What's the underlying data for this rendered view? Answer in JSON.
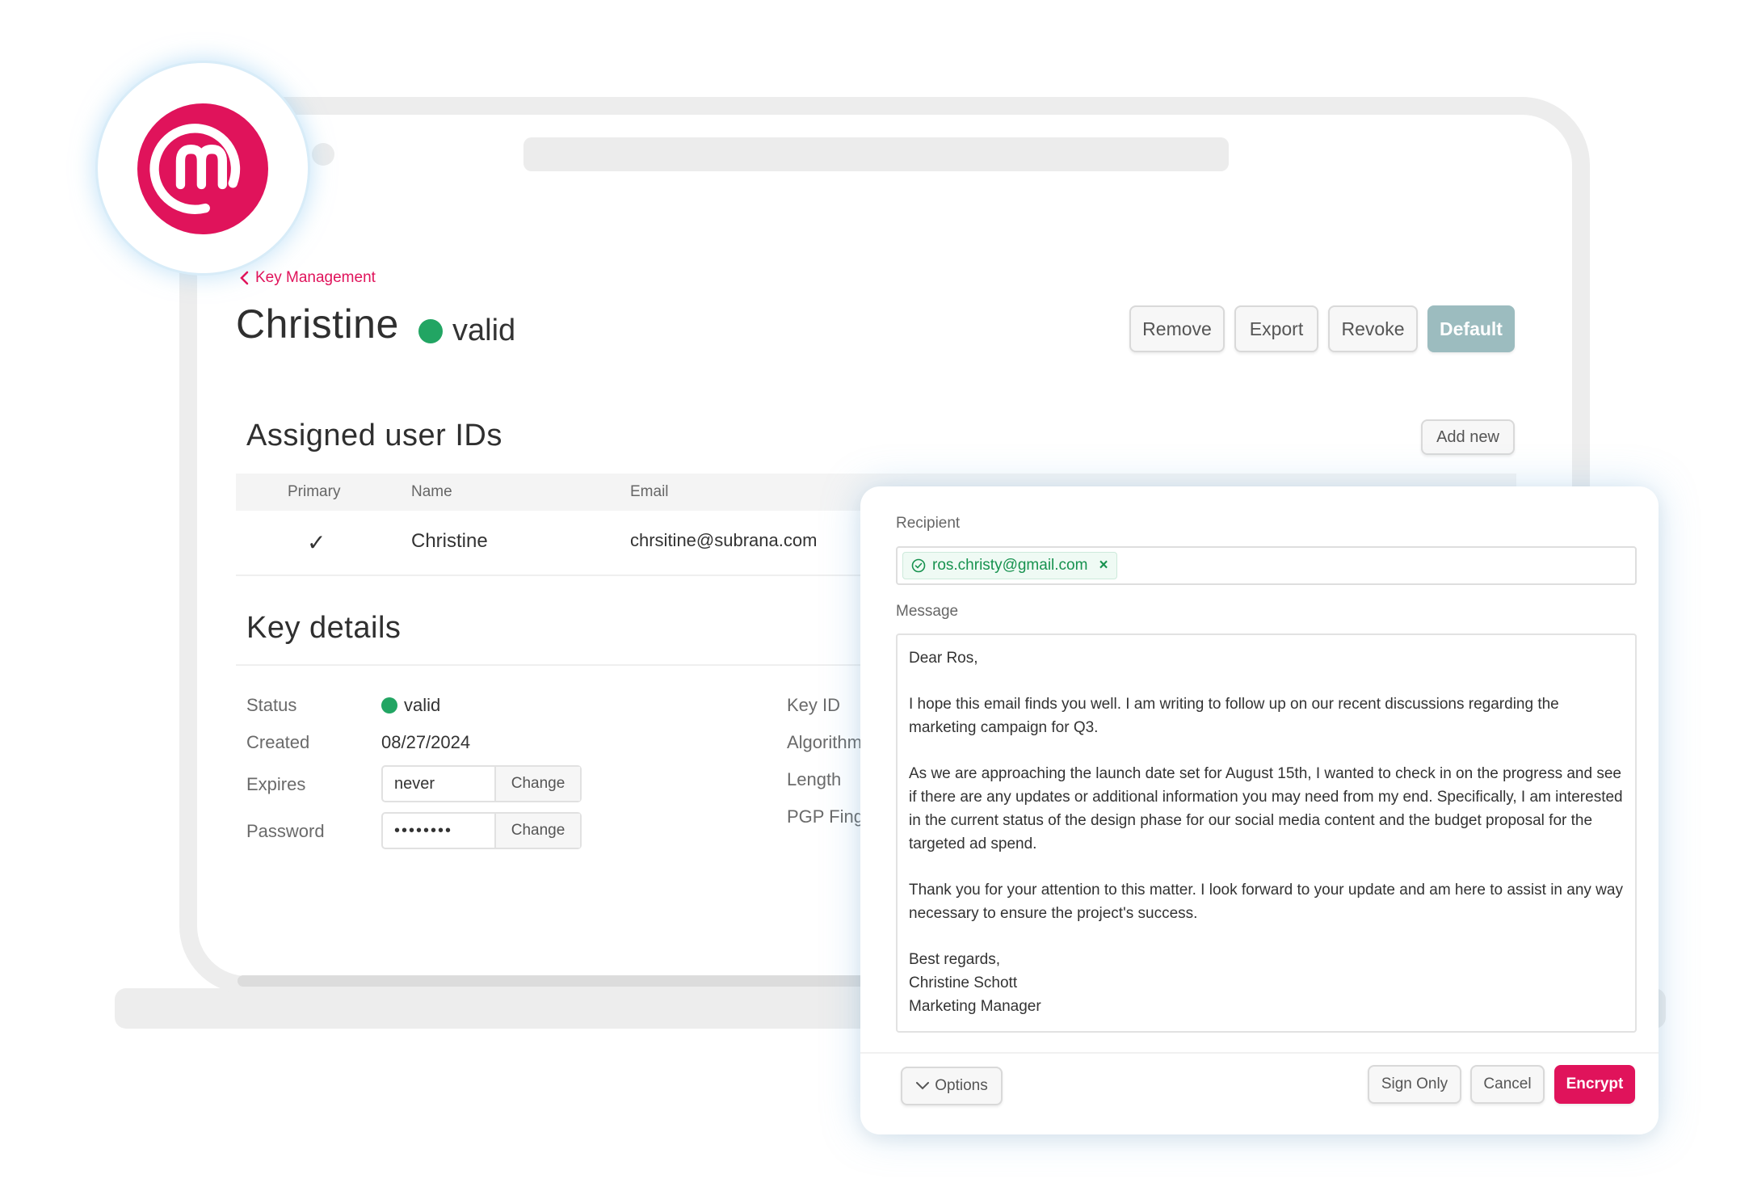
{
  "brand": {
    "logo_icon": "m-mark-logo",
    "accent_color": "#e0135b"
  },
  "nav": {
    "back_label": "Key Management"
  },
  "key": {
    "title": "Christine",
    "status": "valid",
    "status_color": "#22a563",
    "actions": [
      "Remove",
      "Export",
      "Revoke",
      "Default"
    ]
  },
  "user_ids": {
    "title": "Assigned user IDs",
    "add_label": "Add new",
    "columns": [
      "Primary",
      "Name",
      "Email"
    ],
    "rows": [
      {
        "primary": "✓",
        "name": "Christine",
        "email": "chrsitine@subrana.com"
      }
    ]
  },
  "details": {
    "title": "Key details",
    "status_label": "Status",
    "status_value": "valid",
    "created_label": "Created",
    "created_value": "08/27/2024",
    "expires_label": "Expires",
    "expires_value": "never",
    "password_label": "Password",
    "password_value": "••••••••",
    "change_label": "Change",
    "right_labels": [
      "Key ID",
      "Algorithm",
      "Length",
      "PGP Fingerprint"
    ]
  },
  "compose": {
    "recipient_label": "Recipient",
    "recipient_email": "ros.christy@gmail.com",
    "message_label": "Message",
    "message_paragraphs": [
      "Dear Ros,",
      "I hope this email finds you well. I am writing to follow up on our recent discussions regarding the marketing campaign for Q3.",
      "As we are approaching the launch date set for August 15th, I wanted to check in on the progress and see if there are any updates or additional information you may need from my end. Specifically, I am interested in the current status of the design phase for our social media content and the budget proposal for the targeted ad spend.",
      "Thank you for your attention to this matter. I look forward to your update and am here to assist in any way necessary to ensure the project's success."
    ],
    "signature_lines": [
      "Best regards,",
      "Christine Schott",
      "Marketing Manager"
    ],
    "options_label": "Options",
    "sign_only_label": "Sign Only",
    "cancel_label": "Cancel",
    "encrypt_label": "Encrypt"
  }
}
